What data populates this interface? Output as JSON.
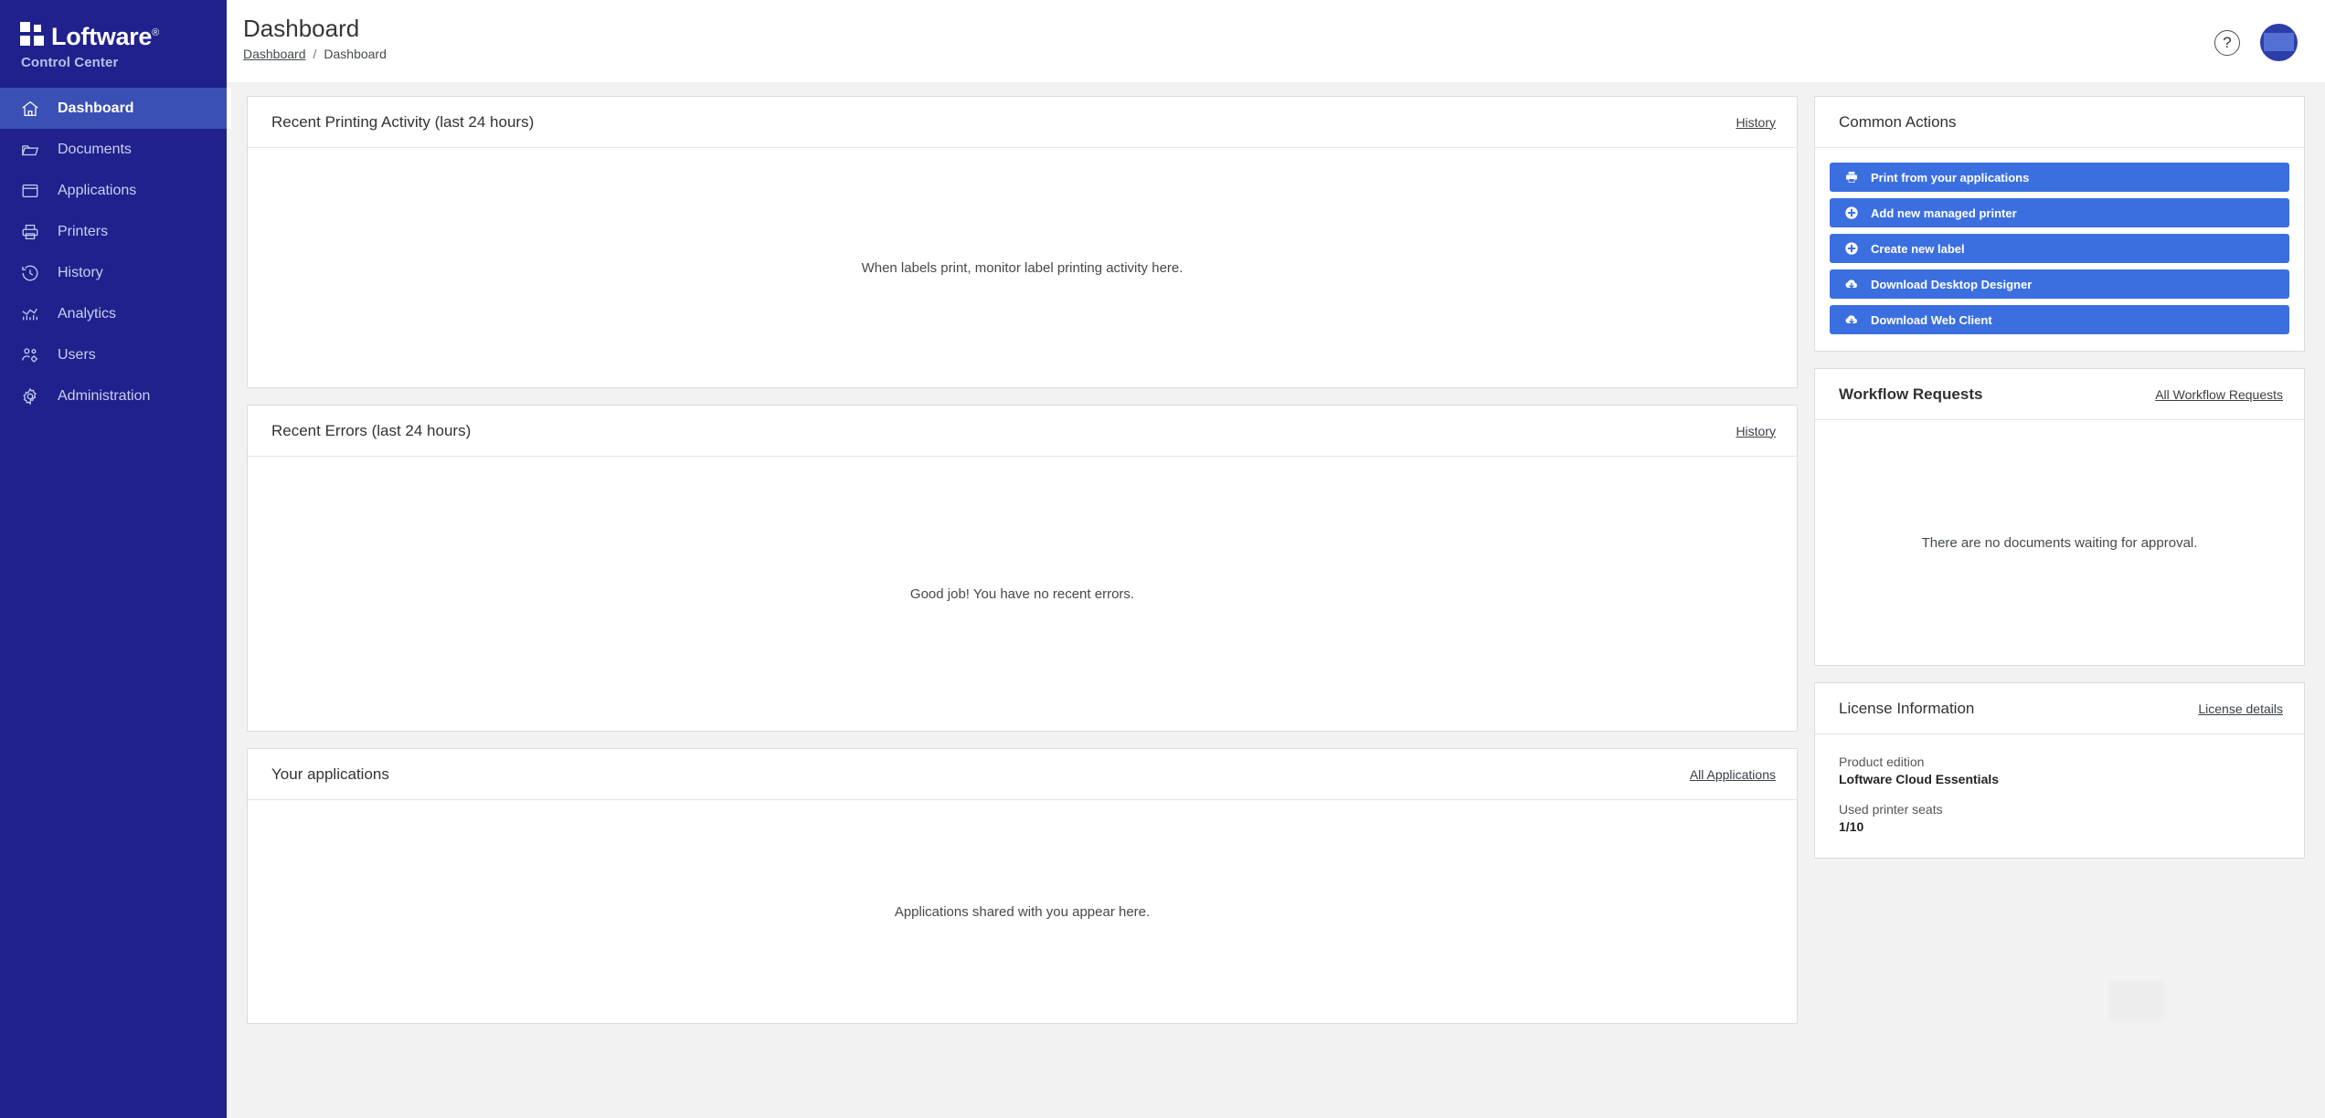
{
  "sidebar": {
    "brand_name": "Loftware",
    "brand_trademark": "®",
    "brand_sub": "Control Center",
    "items": [
      {
        "label": "Dashboard",
        "icon": "home-icon",
        "active": true
      },
      {
        "label": "Documents",
        "icon": "folder-icon",
        "active": false
      },
      {
        "label": "Applications",
        "icon": "window-icon",
        "active": false
      },
      {
        "label": "Printers",
        "icon": "printer-icon",
        "active": false
      },
      {
        "label": "History",
        "icon": "clock-icon",
        "active": false
      },
      {
        "label": "Analytics",
        "icon": "chart-icon",
        "active": false
      },
      {
        "label": "Users",
        "icon": "users-icon",
        "active": false
      },
      {
        "label": "Administration",
        "icon": "gear-icon",
        "active": false
      }
    ]
  },
  "header": {
    "title": "Dashboard",
    "breadcrumb_root": "Dashboard",
    "breadcrumb_separator": "/",
    "breadcrumb_current": "Dashboard",
    "help_glyph": "?",
    "avatar_name": "user-avatar"
  },
  "main": {
    "printing": {
      "title": "Recent Printing Activity (last 24 hours)",
      "link": "History",
      "empty": "When labels print, monitor label printing activity here."
    },
    "errors": {
      "title": "Recent Errors (last 24 hours)",
      "link": "History",
      "empty": "Good job! You have no recent errors."
    },
    "applications": {
      "title": "Your applications",
      "link": "All Applications",
      "empty": "Applications shared with you appear here."
    }
  },
  "side": {
    "common_actions": {
      "title": "Common Actions",
      "buttons": [
        {
          "label": "Print from your applications",
          "icon": "printer-icon"
        },
        {
          "label": "Add new managed printer",
          "icon": "plus-circle-icon"
        },
        {
          "label": "Create new label",
          "icon": "plus-circle-icon"
        },
        {
          "label": "Download Desktop Designer",
          "icon": "cloud-download-icon"
        },
        {
          "label": "Download Web Client",
          "icon": "cloud-download-icon"
        }
      ]
    },
    "workflow": {
      "title": "Workflow Requests",
      "link": "All Workflow Requests",
      "empty": "There are no documents waiting for approval."
    },
    "license": {
      "title": "License Information",
      "link": "License details",
      "edition_label": "Product edition",
      "edition_value": "Loftware Cloud Essentials",
      "seats_label": "Used printer seats",
      "seats_value": "1/10"
    }
  },
  "colors": {
    "sidebar_bg": "#20218c",
    "sidebar_active": "#3b50b5",
    "action_blue": "#3b6fe0",
    "page_bg": "#f2f2f2",
    "card_border": "#dcdcdc"
  }
}
